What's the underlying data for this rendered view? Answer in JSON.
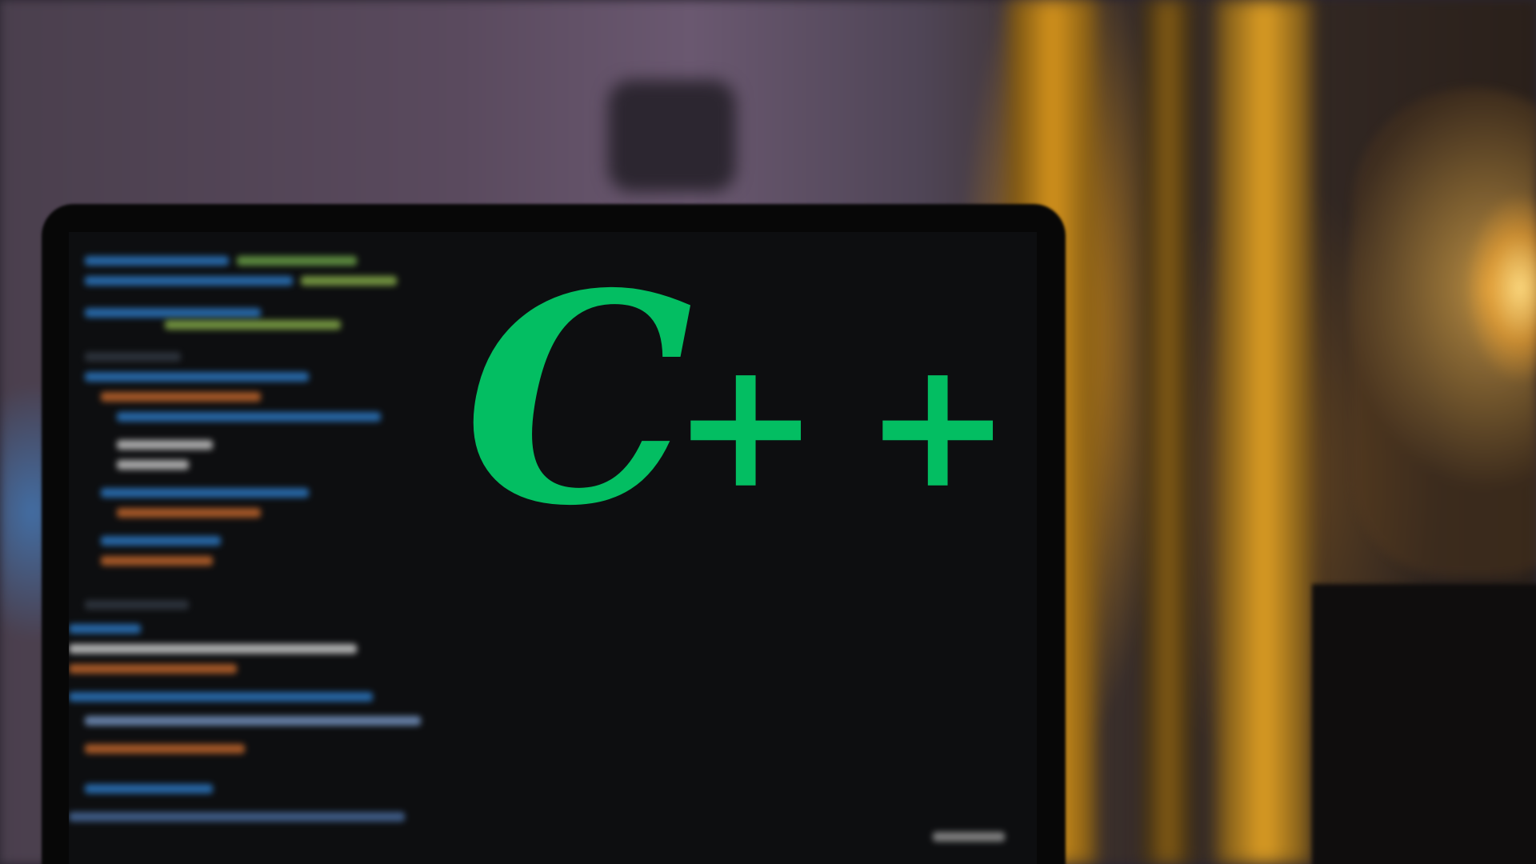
{
  "image": {
    "kind": "photo",
    "logo": {
      "c": "C",
      "plus1": "+",
      "plus2": "+"
    },
    "colors": {
      "logo_green": "#03be62",
      "bulb_glow": "#f0a020",
      "screen": "#0d0e10"
    }
  }
}
